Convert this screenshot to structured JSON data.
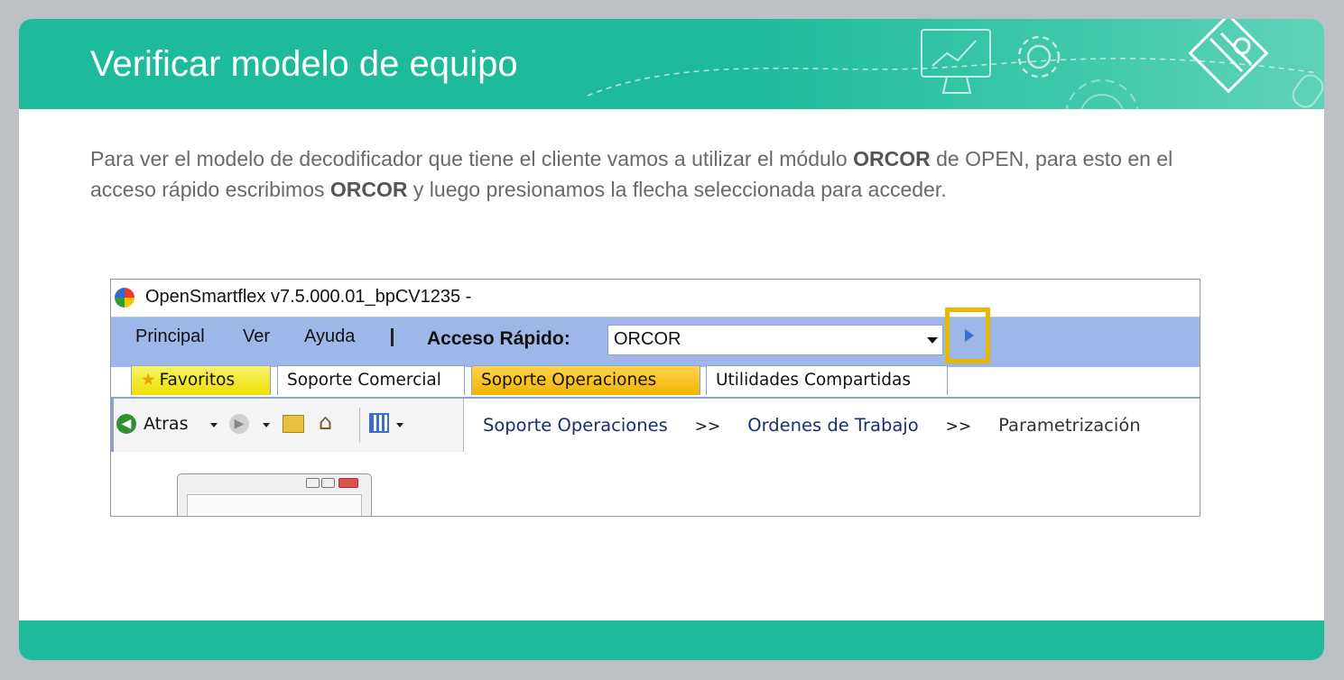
{
  "header": {
    "title": "Verificar modelo de equipo"
  },
  "intro": {
    "text_1": "Para ver el modelo de decodificador que tiene el cliente vamos a utilizar el módulo ",
    "bold_1": "ORCOR",
    "text_2": " de OPEN, para esto en el acceso rápido escribimos ",
    "bold_2": "ORCOR",
    "text_3": " y luego presionamos la flecha seleccionada para acceder."
  },
  "app": {
    "title": "OpenSmartflex v7.5.000.01_bpCV1235 -",
    "menu": [
      "Principal",
      "Ver",
      "Ayuda"
    ],
    "quick_access_label": "Acceso Rápido:",
    "quick_access_value": "ORCOR",
    "tabs": [
      "Favoritos",
      "Soporte Comercial",
      "Soporte Operaciones",
      "Utilidades Compartidas"
    ],
    "active_tab": "Soporte Operaciones",
    "back_label": "Atras",
    "breadcrumb": [
      "Soporte Operaciones",
      "Ordenes de Trabajo",
      "Parametrización"
    ],
    "breadcrumb_separator": ">>"
  },
  "colors": {
    "accent": "#1dbb9a",
    "menubar": "#9db8e8",
    "highlight": "#e8b800"
  }
}
